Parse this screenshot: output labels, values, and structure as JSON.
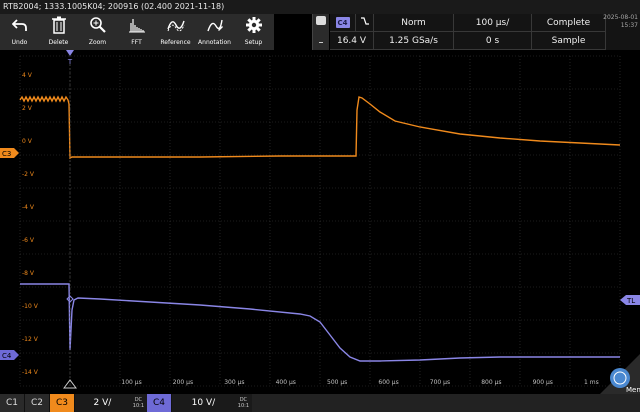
{
  "title": "RTB2004; 1333.1005K04; 200916 (02.400 2021-11-18)",
  "toolbar": [
    {
      "label": "Undo",
      "icon": "undo-icon"
    },
    {
      "label": "Delete",
      "icon": "trash-icon"
    },
    {
      "label": "Zoom",
      "icon": "zoom-icon"
    },
    {
      "label": "FFT",
      "icon": "fft-icon"
    },
    {
      "label": "Reference",
      "icon": "reference-icon"
    },
    {
      "label": "Annotation",
      "icon": "annotation-icon"
    },
    {
      "label": "Setup",
      "icon": "gear-icon"
    }
  ],
  "acq": {
    "source": "C4",
    "slope": "⌄",
    "trigger_level": "16.4 V",
    "mode": "Norm",
    "sample_rate": "1.25 GSa/s",
    "timebase": "100 µs/",
    "position": "0 s",
    "status": "Complete",
    "acq_mode": "Sample"
  },
  "datetime": {
    "date": "2025-08-01",
    "time": "15:37"
  },
  "grid": {
    "v_labels": [
      "4 V",
      "2 V",
      "0 V",
      "-2 V",
      "-4 V",
      "-6 V",
      "-8 V",
      "-10 V",
      "-12 V",
      "-14 V"
    ],
    "t_labels": [
      "100 µs",
      "200 µs",
      "300 µs",
      "400 µs",
      "500 µs",
      "600 µs",
      "700 µs",
      "800 µs",
      "900 µs",
      "1 ms"
    ],
    "markers": {
      "c3": "C3",
      "c4": "C4",
      "tl": "TL",
      "t": "T"
    }
  },
  "channels": {
    "c1": "C1",
    "c2": "C2",
    "c3": "C3",
    "c4": "C4",
    "c3_scale": "2 V/",
    "c4_scale": "10 V/",
    "c3_cpl_top": "DC",
    "c3_cpl_bot": "10:1",
    "c4_cpl_top": "DC",
    "c4_cpl_bot": "10:1"
  },
  "menu": "Menu",
  "colors": {
    "c3": "#f08a1c",
    "c4": "#8a86e6",
    "grid": "#3a3a3a"
  }
}
